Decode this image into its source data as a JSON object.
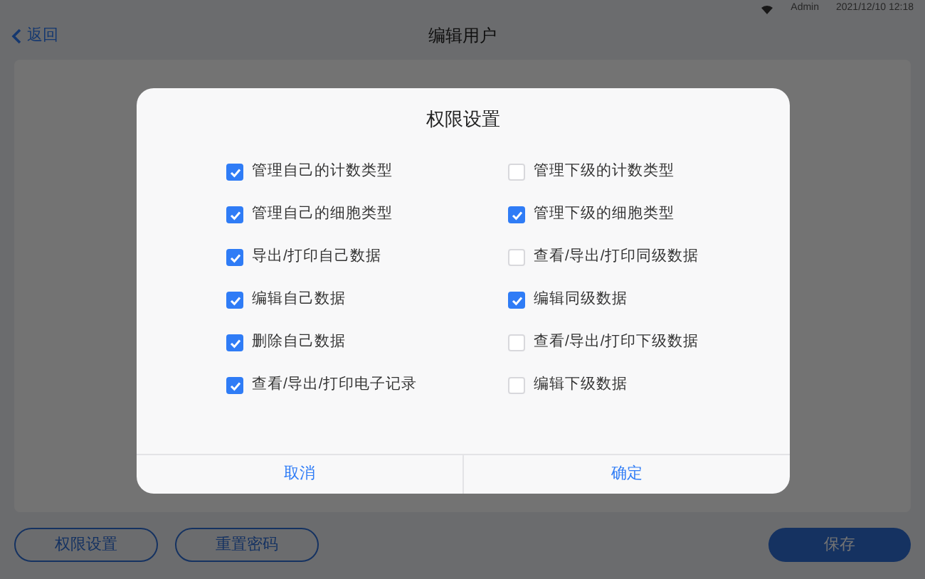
{
  "status_bar": {
    "user": "Admin",
    "datetime": "2021/12/10 12:18"
  },
  "header": {
    "back": "返回",
    "title": "编辑用户"
  },
  "bottom_buttons": [
    {
      "label": "权限设置",
      "kind": "outline"
    },
    {
      "label": "重置密码",
      "kind": "outline"
    },
    {
      "label": "保存",
      "kind": "primary"
    }
  ],
  "dialog": {
    "title": "权限设置",
    "permissions": [
      {
        "label": "管理自己的计数类型",
        "checked": true
      },
      {
        "label": "管理下级的计数类型",
        "checked": false
      },
      {
        "label": "管理自己的细胞类型",
        "checked": true
      },
      {
        "label": "管理下级的细胞类型",
        "checked": true
      },
      {
        "label": "导出/打印自己数据",
        "checked": true
      },
      {
        "label": "查看/导出/打印同级数据",
        "checked": false
      },
      {
        "label": "编辑自己数据",
        "checked": true
      },
      {
        "label": "编辑同级数据",
        "checked": true
      },
      {
        "label": "删除自己数据",
        "checked": true
      },
      {
        "label": "查看/导出/打印下级数据",
        "checked": false
      },
      {
        "label": "查看/导出/打印电子记录",
        "checked": true
      },
      {
        "label": "编辑下级数据",
        "checked": false
      }
    ],
    "buttons": [
      "取消",
      "确定"
    ]
  }
}
